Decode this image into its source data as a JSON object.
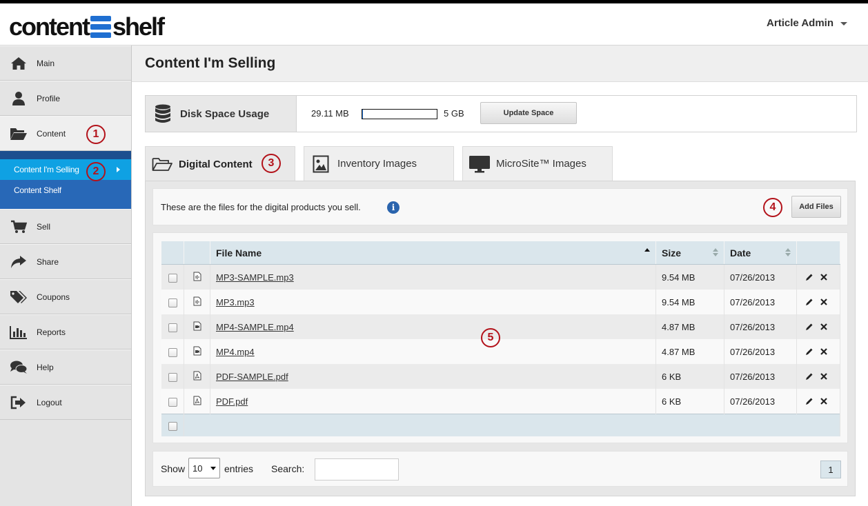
{
  "header": {
    "logo_left": "content",
    "logo_right": "shelf",
    "user_menu": "Article Admin"
  },
  "colors": {
    "accent": "#1f6fd1",
    "subnav": "#2868b7",
    "subnav_active": "#0fa1e3",
    "callout": "#b3121a"
  },
  "sidebar": {
    "items": [
      {
        "label": "Main",
        "icon": "home-icon"
      },
      {
        "label": "Profile",
        "icon": "user-icon"
      },
      {
        "label": "Content",
        "icon": "folder-open-icon"
      },
      {
        "label": "Sell",
        "icon": "cart-icon"
      },
      {
        "label": "Share",
        "icon": "share-icon"
      },
      {
        "label": "Coupons",
        "icon": "tags-icon"
      },
      {
        "label": "Reports",
        "icon": "bar-chart-icon"
      },
      {
        "label": "Help",
        "icon": "comments-icon"
      },
      {
        "label": "Logout",
        "icon": "logout-icon"
      }
    ],
    "subitems": [
      {
        "label": "Content I'm Selling",
        "active": true
      },
      {
        "label": "Content Shelf",
        "active": false
      }
    ]
  },
  "page": {
    "title": "Content I'm Selling"
  },
  "disk": {
    "label": "Disk Space Usage",
    "used": "29.11 MB",
    "total": "5 GB",
    "usage_fraction": 0.006,
    "button": "Update Space"
  },
  "tabs": [
    {
      "label": "Digital Content",
      "icon": "folder-open-icon",
      "active": true
    },
    {
      "label": "Inventory Images",
      "icon": "image-icon",
      "active": false
    },
    {
      "label": "MicroSite™ Images",
      "icon": "monitor-icon",
      "active": false
    }
  ],
  "info": {
    "text": "These are the files for the digital products you sell.",
    "add_files": "Add Files"
  },
  "table": {
    "columns": {
      "name": "File Name",
      "size": "Size",
      "date": "Date"
    },
    "rows": [
      {
        "name": "MP3-SAMPLE.mp3",
        "size": "9.54 MB",
        "date": "07/26/2013",
        "type": "audio"
      },
      {
        "name": "MP3.mp3",
        "size": "9.54 MB",
        "date": "07/26/2013",
        "type": "audio"
      },
      {
        "name": "MP4-SAMPLE.mp4",
        "size": "4.87 MB",
        "date": "07/26/2013",
        "type": "video"
      },
      {
        "name": "MP4.mp4",
        "size": "4.87 MB",
        "date": "07/26/2013",
        "type": "video"
      },
      {
        "name": "PDF-SAMPLE.pdf",
        "size": "6 KB",
        "date": "07/26/2013",
        "type": "pdf"
      },
      {
        "name": "PDF.pdf",
        "size": "6 KB",
        "date": "07/26/2013",
        "type": "pdf"
      }
    ]
  },
  "footer": {
    "show": "Show",
    "page_size": "10",
    "entries": "entries",
    "search_label": "Search:",
    "search_value": "",
    "page": "1"
  },
  "callouts": [
    "1",
    "2",
    "3",
    "4",
    "5"
  ]
}
